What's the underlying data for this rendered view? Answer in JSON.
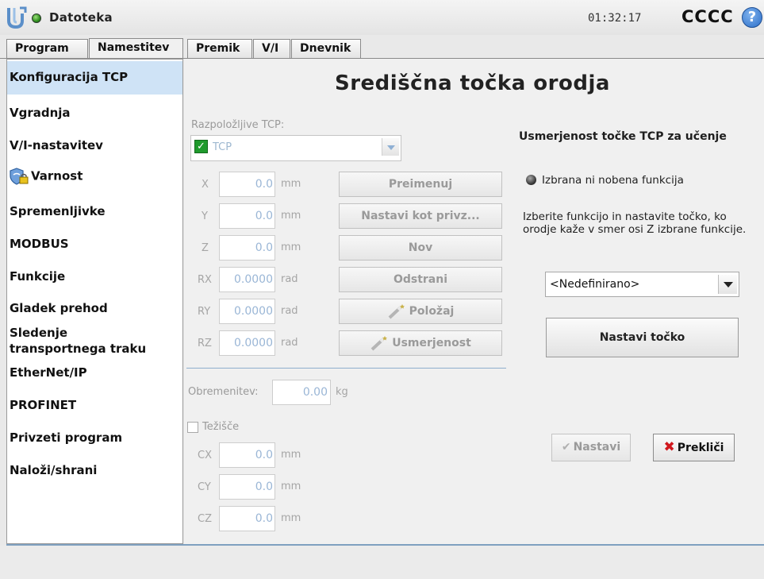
{
  "header": {
    "file_label": "Datoteka",
    "clock": "01:32:17",
    "robot_name": "CCCC",
    "help": "?"
  },
  "tabs": [
    {
      "label": "Program",
      "active": false
    },
    {
      "label": "Namestitev",
      "active": true
    },
    {
      "label": "Premik",
      "active": false
    },
    {
      "label": "V/I",
      "active": false
    },
    {
      "label": "Dnevnik",
      "active": false
    }
  ],
  "sidebar": {
    "items": [
      {
        "label": "Konfiguracija TCP",
        "selected": true
      },
      {
        "label": "Vgradnja"
      },
      {
        "label": "V/I-nastavitev"
      },
      {
        "label": "Varnost",
        "icon": "shield-lock-icon"
      },
      {
        "label": "Spremenljivke"
      },
      {
        "label": "MODBUS"
      },
      {
        "label": "Funkcije"
      },
      {
        "label": "Gladek prehod"
      },
      {
        "label": "Sledenje transportnega traku"
      },
      {
        "label": "EtherNet/IP"
      },
      {
        "label": "PROFINET"
      },
      {
        "label": "Privzeti program"
      },
      {
        "label": "Naloži/shrani"
      }
    ]
  },
  "main": {
    "title": "Središčna točka orodja",
    "available_tcp_label": "Razpoložljive TCP:",
    "tcp_select_value": "TCP",
    "coords": [
      {
        "axis": "X",
        "value": "0.0",
        "unit": "mm"
      },
      {
        "axis": "Y",
        "value": "0.0",
        "unit": "mm"
      },
      {
        "axis": "Z",
        "value": "0.0",
        "unit": "mm"
      },
      {
        "axis": "RX",
        "value": "0.0000",
        "unit": "rad"
      },
      {
        "axis": "RY",
        "value": "0.0000",
        "unit": "rad"
      },
      {
        "axis": "RZ",
        "value": "0.0000",
        "unit": "rad"
      }
    ],
    "buttons": {
      "rename": "Preimenuj",
      "set_default": "Nastavi kot privz...",
      "new": "Nov",
      "remove": "Odstrani",
      "position": "Položaj",
      "orientation": "Usmerjenost"
    },
    "payload_label": "Obremenitev:",
    "payload_value": "0.00",
    "payload_unit": "kg",
    "cog_label": "Težišče",
    "cog": [
      {
        "axis": "CX",
        "value": "0.0",
        "unit": "mm"
      },
      {
        "axis": "CY",
        "value": "0.0",
        "unit": "mm"
      },
      {
        "axis": "CZ",
        "value": "0.0",
        "unit": "mm"
      }
    ]
  },
  "orientation_panel": {
    "title": "Usmerjenost točke TCP za učenje",
    "status": "Izbrana ni nobena funkcija",
    "description": "Izberite funkcijo in nastavite točko, ko orodje kaže v smer osi Z izbrane funkcije.",
    "feature_select": "<Nedefinirano>",
    "set_point_button": "Nastavi točko",
    "ok_button": "Nastavi",
    "cancel_button": "Prekliči"
  },
  "colors": {
    "selected_row": "#cfe3f6",
    "status_green": "#2f8f1e",
    "cancel_red": "#d0181e",
    "separator_blue": "#8faecd"
  }
}
